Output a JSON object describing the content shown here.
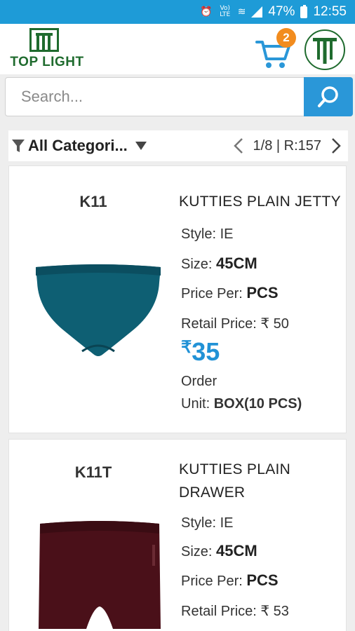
{
  "status_bar": {
    "battery": "47%",
    "time": "12:55",
    "network": "Vo) LTE"
  },
  "header": {
    "logo_text": "TOP LIGHT",
    "cart_count": "2"
  },
  "search": {
    "placeholder": "Search..."
  },
  "filter": {
    "category_label": "All Categori...",
    "pagination": "1/8 | R:157"
  },
  "products": [
    {
      "code": "K11",
      "name": "KUTTIES PLAIN JETTY",
      "style_label": "Style:",
      "style": "IE",
      "size_label": "Size:",
      "size": "45CM",
      "price_per_label": "Price Per:",
      "price_per": "PCS",
      "retail_label": "Retail Price:",
      "retail": "₹ 50",
      "currency": "₹",
      "price": "35",
      "order_label": "Order",
      "unit_label": "Unit:",
      "unit": "BOX(10 PCS)",
      "color": "#0e5f73"
    },
    {
      "code": "K11T",
      "name": "KUTTIES PLAIN DRAWER",
      "style_label": "Style:",
      "style": "IE",
      "size_label": "Size:",
      "size": "45CM",
      "price_per_label": "Price Per:",
      "price_per": "PCS",
      "retail_label": "Retail Price:",
      "retail": "₹ 53",
      "color": "#4a1019"
    }
  ],
  "colors": {
    "status_bar": "#1e9bd7",
    "accent": "#2a97d8",
    "brand_green": "#1f6b2e",
    "badge": "#f28c1e"
  }
}
